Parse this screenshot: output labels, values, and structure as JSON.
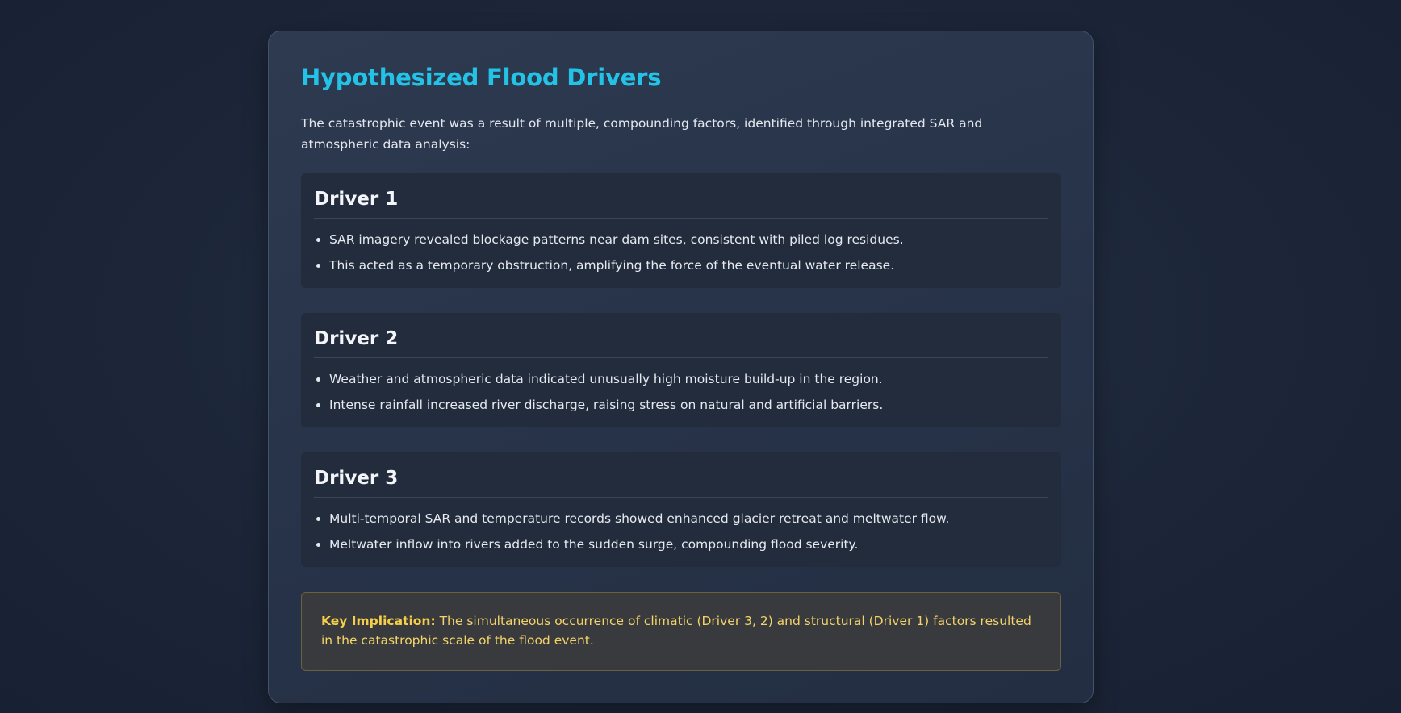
{
  "page": {
    "title": "Hypothesized Flood Drivers",
    "intro": "The catastrophic event was a result of multiple, compounding factors, identified through integrated SAR and atmospheric data analysis:"
  },
  "drivers": [
    {
      "title": "Driver 1",
      "points": [
        "SAR imagery revealed blockage patterns near dam sites, consistent with piled log residues.",
        "This acted as a temporary obstruction, amplifying the force of the eventual water release."
      ]
    },
    {
      "title": "Driver 2",
      "points": [
        "Weather and atmospheric data indicated unusually high moisture build-up in the region.",
        "Intense rainfall increased river discharge, raising stress on natural and artificial barriers."
      ]
    },
    {
      "title": "Driver 3",
      "points": [
        "Multi-temporal SAR and temperature records showed enhanced glacier retreat and meltwater flow.",
        "Meltwater inflow into rivers added to the sudden surge, compounding flood severity."
      ]
    }
  ],
  "implication": {
    "label": "Key Implication:",
    "text": " The simultaneous occurrence of climatic (Driver 3, 2) and structural (Driver 1) factors resulted in the catastrophic scale of the flood event."
  },
  "colors": {
    "accent_title": "#22c3e6",
    "implication_text": "#f3d36a",
    "implication_border": "#6e5f3d"
  }
}
